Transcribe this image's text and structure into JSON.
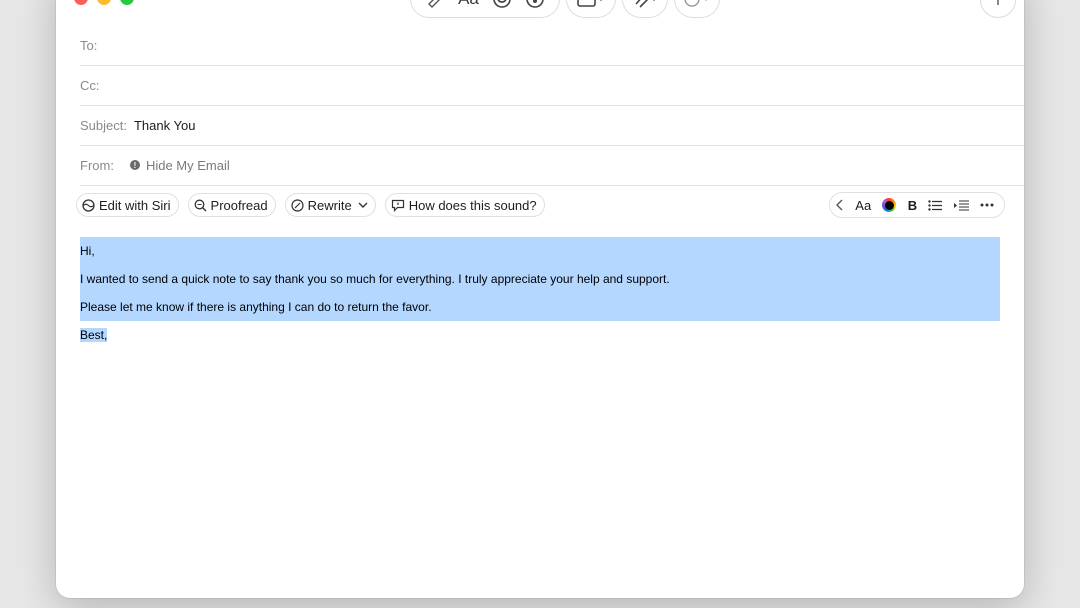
{
  "window": {
    "controls": {
      "close": "close-icon",
      "minimize": "minimize-icon",
      "zoom": "zoom-icon"
    }
  },
  "toolbar": {
    "format_label": "Aa",
    "icons": [
      "writing-tools-icon",
      "emoji-icon",
      "photo-icon",
      "photo-browser-icon",
      "attachment-icon",
      "more-icon"
    ]
  },
  "fields": {
    "to_label": "To:",
    "cc_label": "Cc:",
    "subject_label": "Subject:",
    "subject_value": "Thank You",
    "from_label": "From:",
    "from_value": "Hide My Email"
  },
  "ai_tools": {
    "edit_siri": "Edit with Siri",
    "proofread": "Proofread",
    "rewrite": "Rewrite",
    "how_sound": "How does this sound?"
  },
  "format_bar": {
    "font_label": "Aa",
    "bold_label": "B"
  },
  "message": {
    "lines": [
      "Hi,",
      "I wanted to send a quick note to say thank you so much for everything. I truly appreciate your help and support.",
      "Please let me know if there is anything I can do to return the favor.",
      "Best,"
    ],
    "selection_color": "#b3d7ff"
  },
  "colors": {
    "close": "#fe5f57",
    "minimize": "#febc2e",
    "zoom": "#28c840"
  }
}
